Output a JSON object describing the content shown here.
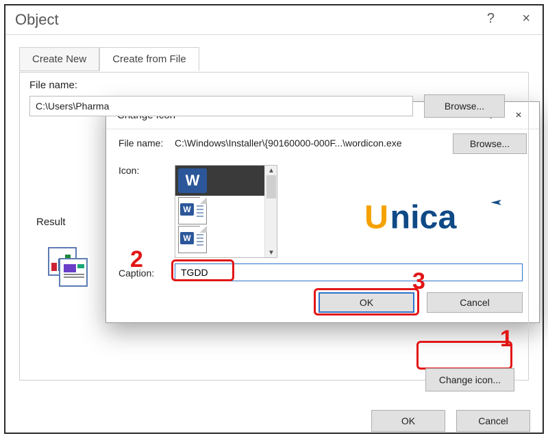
{
  "object_dialog": {
    "title": "Object",
    "help_glyph": "?",
    "close_glyph": "×",
    "tabs": {
      "create_new": "Create New",
      "create_from_file": "Create from File"
    },
    "file_name_label": "File name:",
    "file_name_value": "C:\\Users\\Pharma",
    "browse_label": "Browse...",
    "result_label": "Result",
    "change_icon_label": "Change icon...",
    "ok_label": "OK",
    "cancel_label": "Cancel"
  },
  "change_icon_dialog": {
    "title": "Change Icon",
    "help_glyph": "?",
    "close_glyph": "×",
    "file_name_label": "File name:",
    "file_name_value": "C:\\Windows\\Installer\\{90160000-000F...\\wordicon.exe",
    "browse_label": "Browse...",
    "icon_label": "Icon:",
    "caption_label": "Caption:",
    "caption_value": "TGDD",
    "ok_label": "OK",
    "cancel_label": "Cancel"
  },
  "callouts": {
    "c1": "1",
    "c2": "2",
    "c3": "3"
  },
  "brand": {
    "name": "Unica"
  }
}
